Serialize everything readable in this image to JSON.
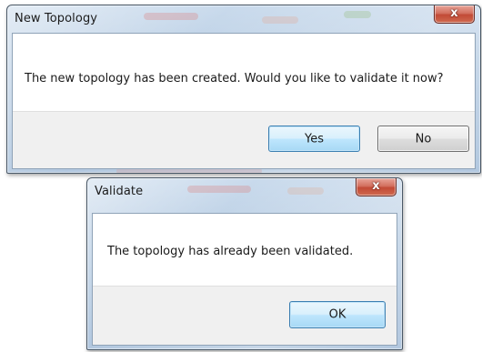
{
  "dialogs": {
    "new_topology": {
      "title": "New Topology",
      "message": "The new topology has been created. Would you like to validate it now?",
      "buttons": {
        "yes": "Yes",
        "no": "No"
      },
      "close_symbol": "x"
    },
    "validate": {
      "title": "Validate",
      "message": "The topology has already been validated.",
      "buttons": {
        "ok": "OK"
      },
      "close_symbol": "x"
    }
  },
  "colors": {
    "frame_glass": "#b5cbe2",
    "close_button": "#c24a36",
    "default_button": "#bee6fd",
    "footer": "#f0f0f0"
  }
}
